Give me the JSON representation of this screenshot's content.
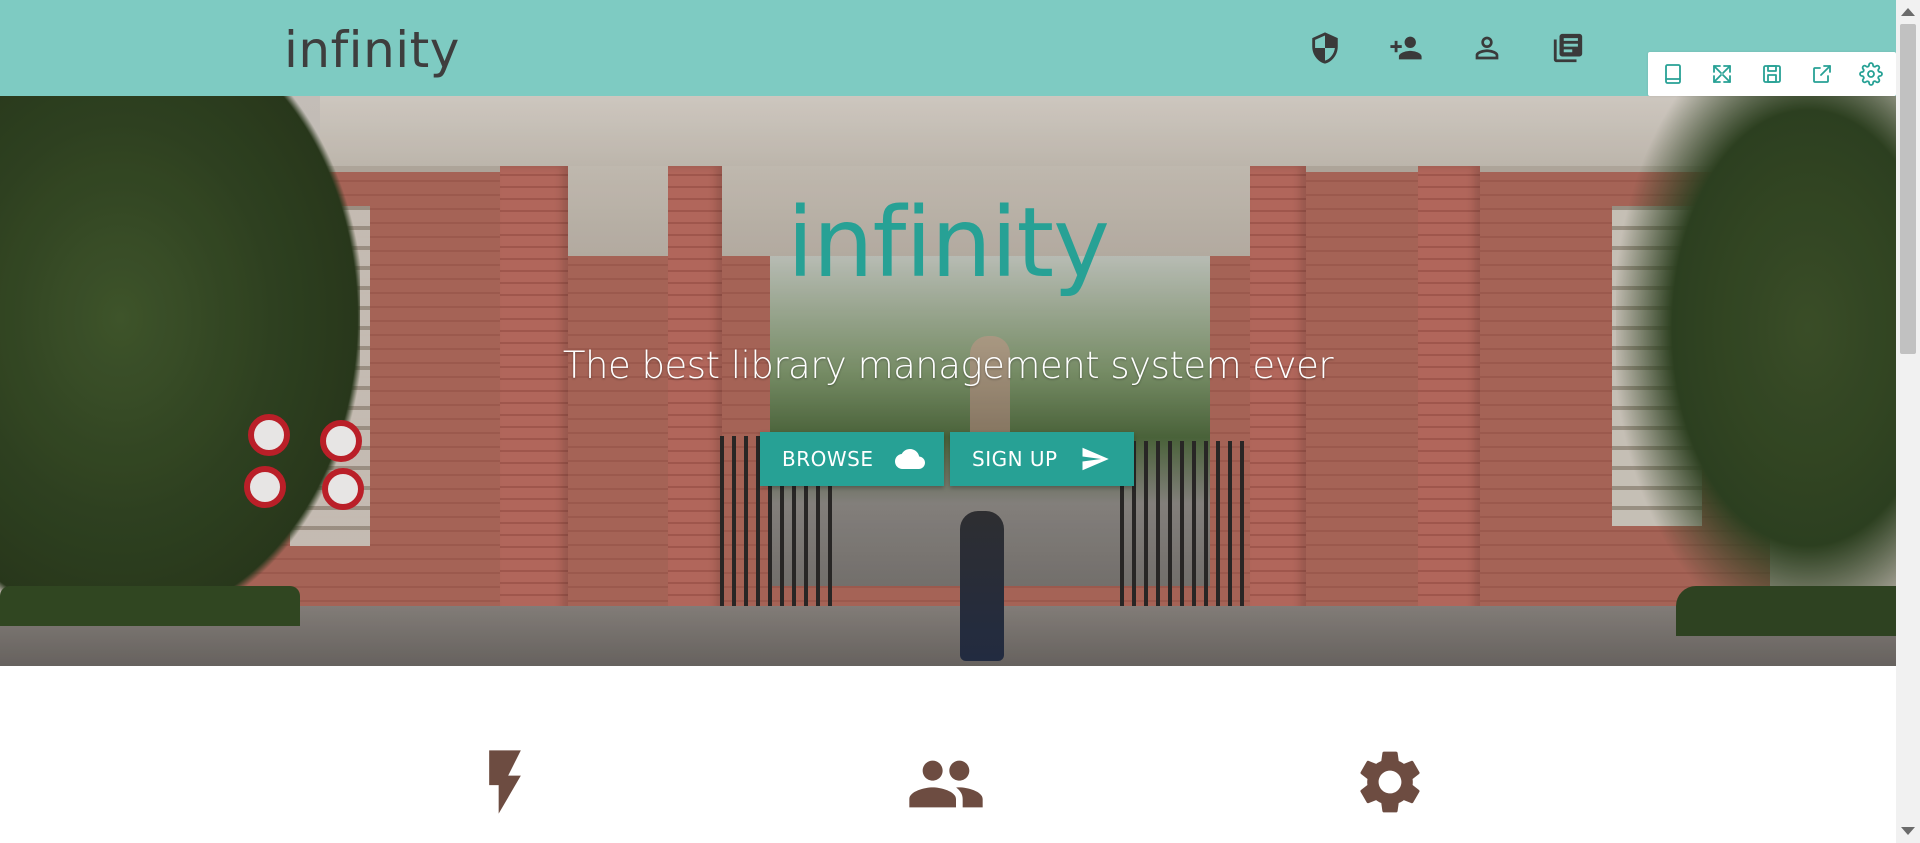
{
  "navbar": {
    "brand": "infinity",
    "icons": [
      "shield-icon",
      "person-add-icon",
      "person-icon",
      "library-books-icon"
    ],
    "background_color": "#7ecbc2"
  },
  "toolbar": {
    "icons": [
      "tablet-icon",
      "fullscreen-icon",
      "save-icon",
      "share-icon",
      "settings-icon"
    ],
    "accent_color": "#27a195"
  },
  "hero": {
    "title": "infinity",
    "subtitle": "The best library management system ever",
    "browse_label": "BROWSE",
    "browse_icon": "cloud-icon",
    "signup_label": "SIGN UP",
    "signup_icon": "send-icon",
    "accent_color": "#27a195"
  },
  "features": {
    "icons": [
      "flash-icon",
      "people-icon",
      "gear-icon"
    ],
    "icon_color": "#6d4c41"
  }
}
